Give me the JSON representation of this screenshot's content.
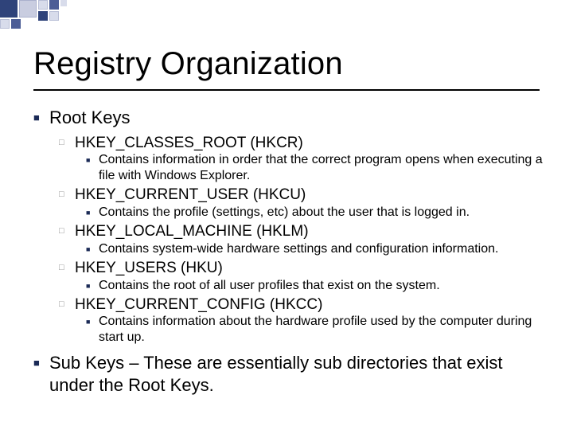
{
  "title": "Registry Organization",
  "l1_1": "Root Keys",
  "l2_1": "HKEY_CLASSES_ROOT (HKCR)",
  "l3_1": "Contains information in order that the correct program opens when executing a file with Windows Explorer.",
  "l2_2": "HKEY_CURRENT_USER (HKCU)",
  "l3_2": "Contains the profile (settings, etc) about the user that is logged in.",
  "l2_3": "HKEY_LOCAL_MACHINE (HKLM)",
  "l3_3": "Contains system-wide hardware settings and configuration information.",
  "l2_4": "HKEY_USERS (HKU)",
  "l3_4": "Contains the root of all user profiles that exist on the system.",
  "l2_5": "HKEY_CURRENT_CONFIG (HKCC)",
  "l3_5": "Contains information about the hardware profile used by the computer during start up.",
  "l1_2": "Sub Keys – These are essentially sub directories that exist under the Root Keys."
}
